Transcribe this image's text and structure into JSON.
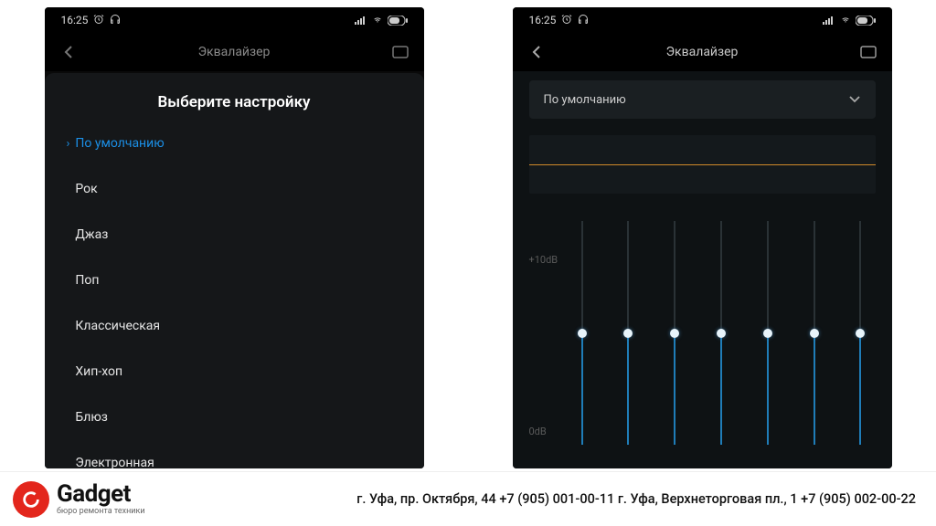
{
  "statusbar": {
    "time": "16:25"
  },
  "appbar": {
    "title": "Эквалайзер"
  },
  "left": {
    "sheet_title": "Выберите настройку",
    "presets": [
      {
        "label": "По умолчанию",
        "selected": true
      },
      {
        "label": "Рок",
        "selected": false
      },
      {
        "label": "Джаз",
        "selected": false
      },
      {
        "label": "Поп",
        "selected": false
      },
      {
        "label": "Классическая",
        "selected": false
      },
      {
        "label": "Хип-хоп",
        "selected": false
      },
      {
        "label": "Блюз",
        "selected": false
      },
      {
        "label": "Электронная",
        "selected": false
      }
    ]
  },
  "right": {
    "dropdown_label": "По умолчанию",
    "axis_top": "+10dB",
    "axis_bottom": "0dB",
    "bands": 7
  },
  "footer": {
    "brand": "Gadget",
    "tagline": "бюро ремонта техники",
    "contacts": "г. Уфа, пр. Октября, 44   +7 (905) 001-00-11 г. Уфа, Верхнеторговая пл., 1   +7 (905) 002-00-22"
  }
}
